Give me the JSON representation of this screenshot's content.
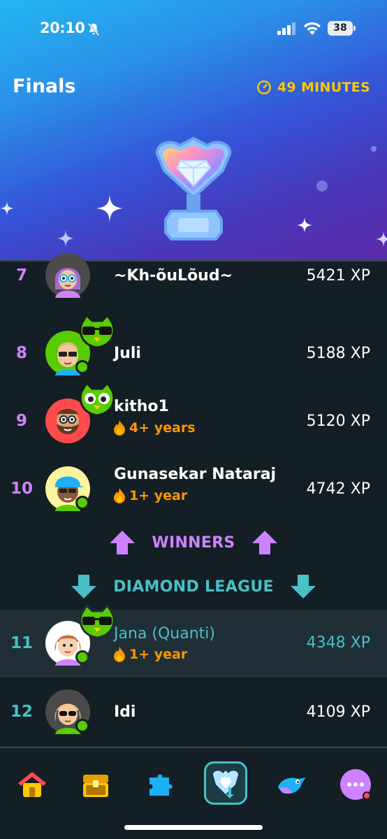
{
  "status": {
    "time": "20:10",
    "battery": "38"
  },
  "header": {
    "title": "Finals",
    "timer": "49 MINUTES"
  },
  "rows": [
    {
      "rank": "7",
      "name": "~Kh-õuLõud~",
      "xp": "5421 XP",
      "streak": ""
    },
    {
      "rank": "8",
      "name": "Juli",
      "xp": "5188 XP",
      "streak": ""
    },
    {
      "rank": "9",
      "name": "kitho1",
      "xp": "5120 XP",
      "streak": "4+ years"
    },
    {
      "rank": "10",
      "name": "Gunasekar Nataraj",
      "xp": "4742 XP",
      "streak": "1+ year"
    },
    {
      "rank": "11",
      "name": "Jana (Quanti)",
      "xp": "4348 XP",
      "streak": "1+ year"
    },
    {
      "rank": "12",
      "name": "Idi",
      "xp": "4109 XP",
      "streak": ""
    }
  ],
  "zones": {
    "winners": "WINNERS",
    "demotion": "DIAMOND LEAGUE"
  },
  "colors": {
    "winner_rank": "#ce82ff",
    "demotion_rank": "#49c0c6",
    "timer": "#ffc800",
    "streak": "#ff9600",
    "online": "#58cc02"
  },
  "tabs": [
    {
      "icon": "home-icon"
    },
    {
      "icon": "treasure-chest-icon"
    },
    {
      "icon": "puzzle-icon"
    },
    {
      "icon": "leaderboard-shield-icon",
      "active": true
    },
    {
      "icon": "bird-icon"
    },
    {
      "icon": "more-icon"
    }
  ]
}
